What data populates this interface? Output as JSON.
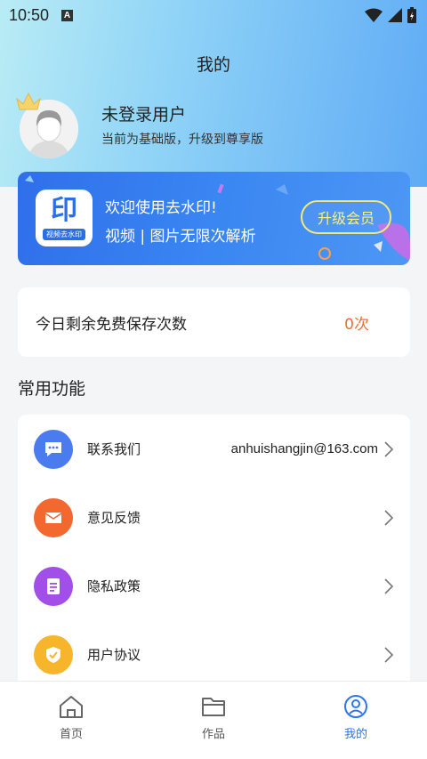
{
  "status_bar": {
    "time": "10:50",
    "notification_badge": "A"
  },
  "header": {
    "title": "我的"
  },
  "user": {
    "name": "未登录用户",
    "subtitle": "当前为基础版，升级到尊享版"
  },
  "vip_banner": {
    "logo_glyph": "印",
    "logo_tag": "视频去水印",
    "line1": "欢迎使用去水印!",
    "line2": "视频 | 图片无限次解析",
    "upgrade_label": "升级会员"
  },
  "quota": {
    "label": "今日剩余免费保存次数",
    "value": "0次"
  },
  "section": {
    "title": "常用功能"
  },
  "functions": [
    {
      "label": "联系我们",
      "value": "anhuishangjin@163.com",
      "icon": "chat-icon",
      "color": "#4a7cf0"
    },
    {
      "label": "意见反馈",
      "value": "",
      "icon": "mail-icon",
      "color": "#f3682f"
    },
    {
      "label": "隐私政策",
      "value": "",
      "icon": "document-icon",
      "color": "#a24ee8"
    },
    {
      "label": "用户协议",
      "value": "",
      "icon": "shield-check-icon",
      "color": "#f7b52c"
    }
  ],
  "tabs": [
    {
      "label": "首页",
      "icon": "home-icon",
      "active": false
    },
    {
      "label": "作品",
      "icon": "folder-icon",
      "active": false
    },
    {
      "label": "我的",
      "icon": "user-circle-icon",
      "active": true
    }
  ],
  "colors": {
    "accent": "#2f74e8",
    "quota_value": "#f36b2f",
    "upgrade_button": "#f3e97a"
  }
}
